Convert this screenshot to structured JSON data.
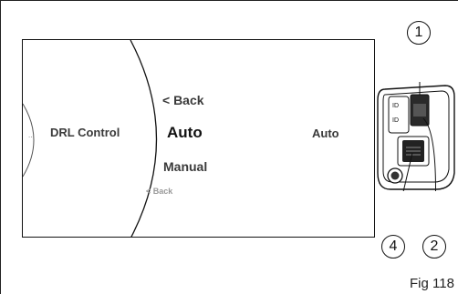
{
  "screen": {
    "left_item": "DRL Control",
    "left_dots": "...",
    "menu": {
      "back_top": "< Back",
      "selected": "Auto",
      "option": "Manual",
      "back_bottom": "< Back"
    },
    "current_value": "Auto"
  },
  "callouts": [
    "1",
    "2",
    "4"
  ],
  "switch_icons": {
    "upper": "ID",
    "lower": "ID"
  },
  "figure_label": "Fig 118"
}
